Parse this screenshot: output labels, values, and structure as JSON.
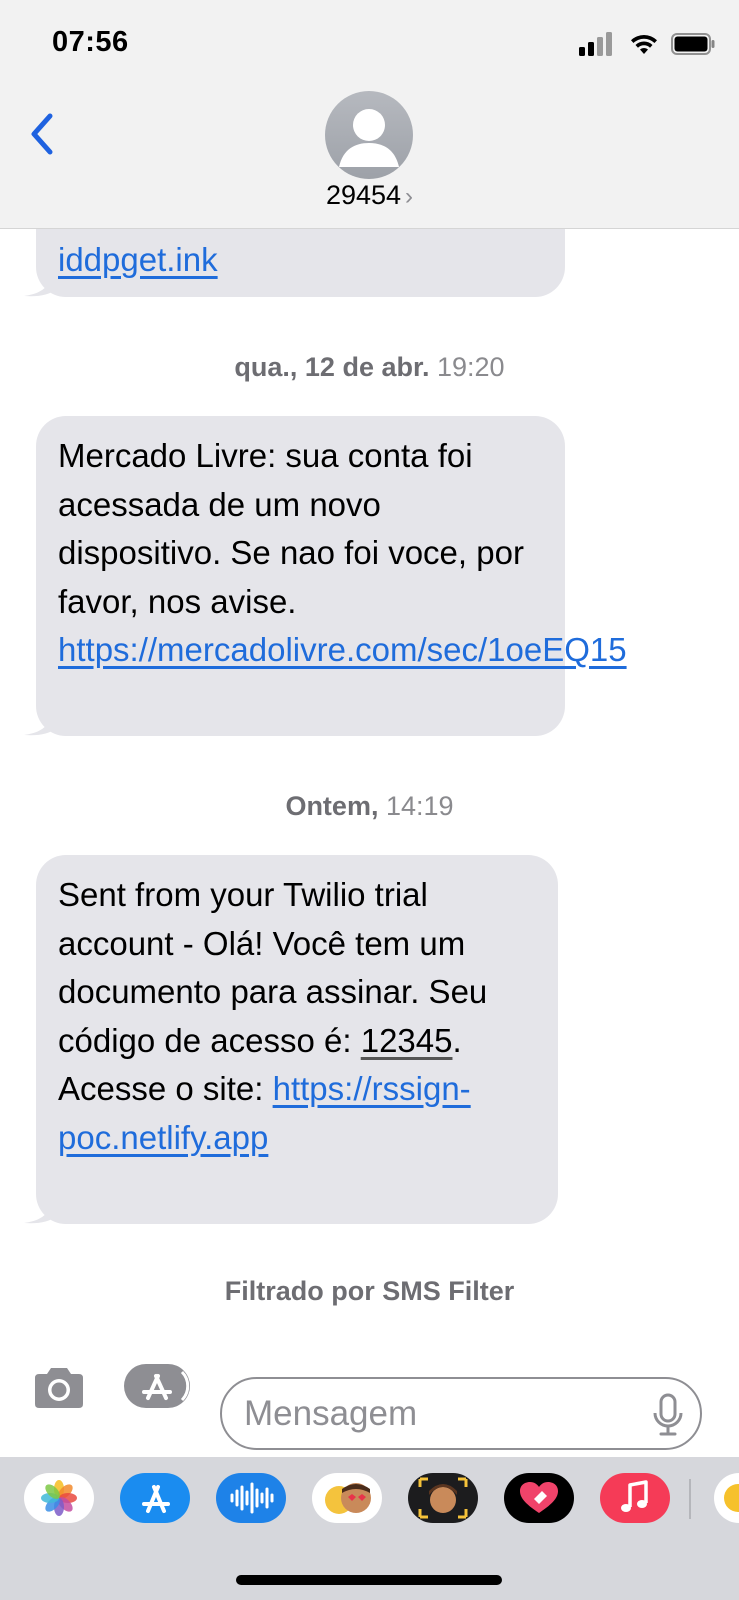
{
  "status_bar": {
    "time": "07:56"
  },
  "header": {
    "contact": "29454",
    "chevron": "›",
    "back_icon": "chevron-left-icon",
    "avatar_icon": "person-silhouette-icon"
  },
  "messages": {
    "partial": {
      "line": "iddpget.ink"
    },
    "ts1": {
      "day": "qua., 12 de abr.",
      "time": "19:20"
    },
    "msg1": {
      "text": "Mercado Livre: sua conta foi acessada de um novo dispositivo. Se nao foi voce, por favor, nos avise.",
      "link": "https://mercadolivre.com/sec/1oeEQ15"
    },
    "ts2": {
      "day": "Ontem,",
      "time": "14:19"
    },
    "msg2": {
      "text_before_code": "Sent from your Twilio trial account - Olá! Você tem um documento para assinar. Seu código de acesso é:",
      "code": "12345",
      "text_after_code": ". Acesse o site:",
      "link": "https://rssign-poc.netlify.app"
    }
  },
  "footer_note": "Filtrado por SMS Filter",
  "compose": {
    "placeholder": "Mensagem",
    "camera_icon": "camera-icon",
    "apps_icon": "app-store-icon",
    "mic_icon": "microphone-icon"
  },
  "drawer_apps": [
    "photos-icon",
    "app-store-icon",
    "audio-message-icon",
    "memoji-stickers-icon",
    "memoji-icon",
    "digital-touch-icon",
    "music-icon"
  ],
  "colors": {
    "bubble": "#e5e5ea",
    "link": "#1f6cdb",
    "ios_blue": "#1f62e0",
    "header_bg": "#f2f2f2",
    "drawer_bg": "#d6d7dc"
  }
}
